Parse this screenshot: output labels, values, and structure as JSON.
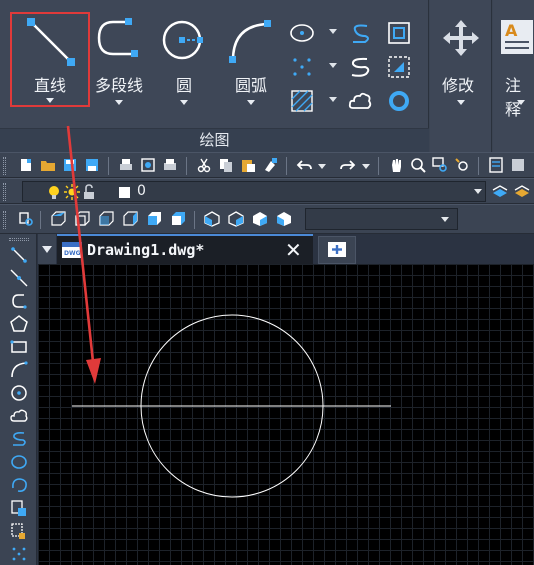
{
  "ribbon": {
    "draw_panel": {
      "title": "绘图",
      "line_label": "直线",
      "polyline_label": "多段线",
      "circle_label": "圆",
      "arc_label": "圆弧"
    },
    "modify_label": "修改",
    "annotation_label": "注释"
  },
  "layer_toolbar": {
    "current_layer": "0"
  },
  "document": {
    "tab_title": "Drawing1.dwg*",
    "close_glyph": "✕"
  },
  "colors": {
    "highlight": "#e03a3a",
    "ribbon_bg": "#3e4757",
    "canvas_bg": "#000000",
    "accent_blue": "#3fa9f5"
  },
  "icons": {
    "line": "line-icon",
    "polyline": "polyline-icon",
    "circle": "circle-icon",
    "arc": "arc-icon",
    "modify": "move-icon",
    "annotation": "text-icon"
  }
}
